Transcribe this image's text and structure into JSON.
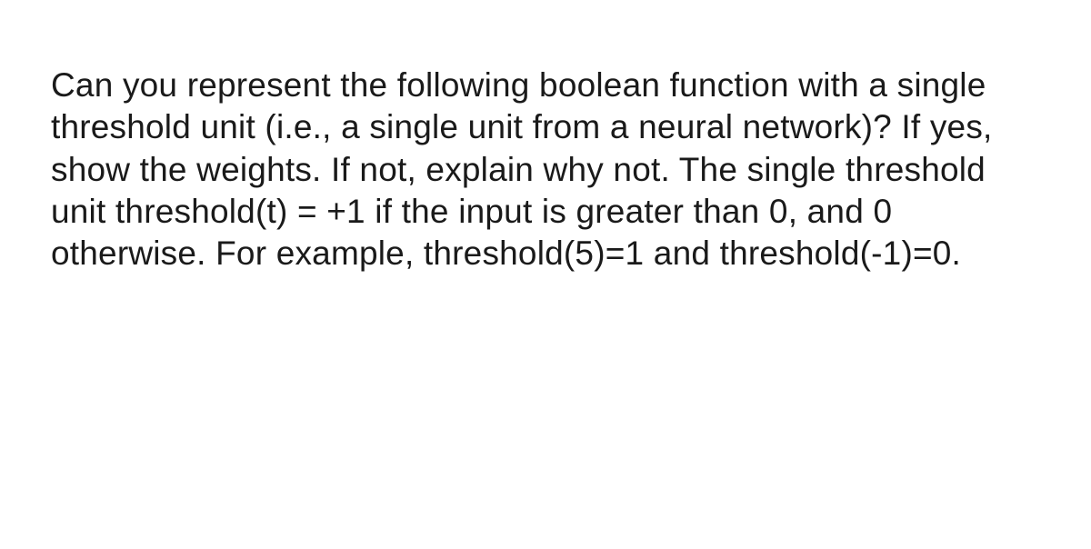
{
  "question": {
    "text": "Can you represent the following boolean function with a single threshold unit (i.e., a single unit from a neural network)? If yes, show the weights. If not, explain why not. The single threshold unit threshold(t) = +1 if the input is greater than 0, and 0 otherwise. For example, threshold(5)=1 and threshold(-1)=0."
  }
}
